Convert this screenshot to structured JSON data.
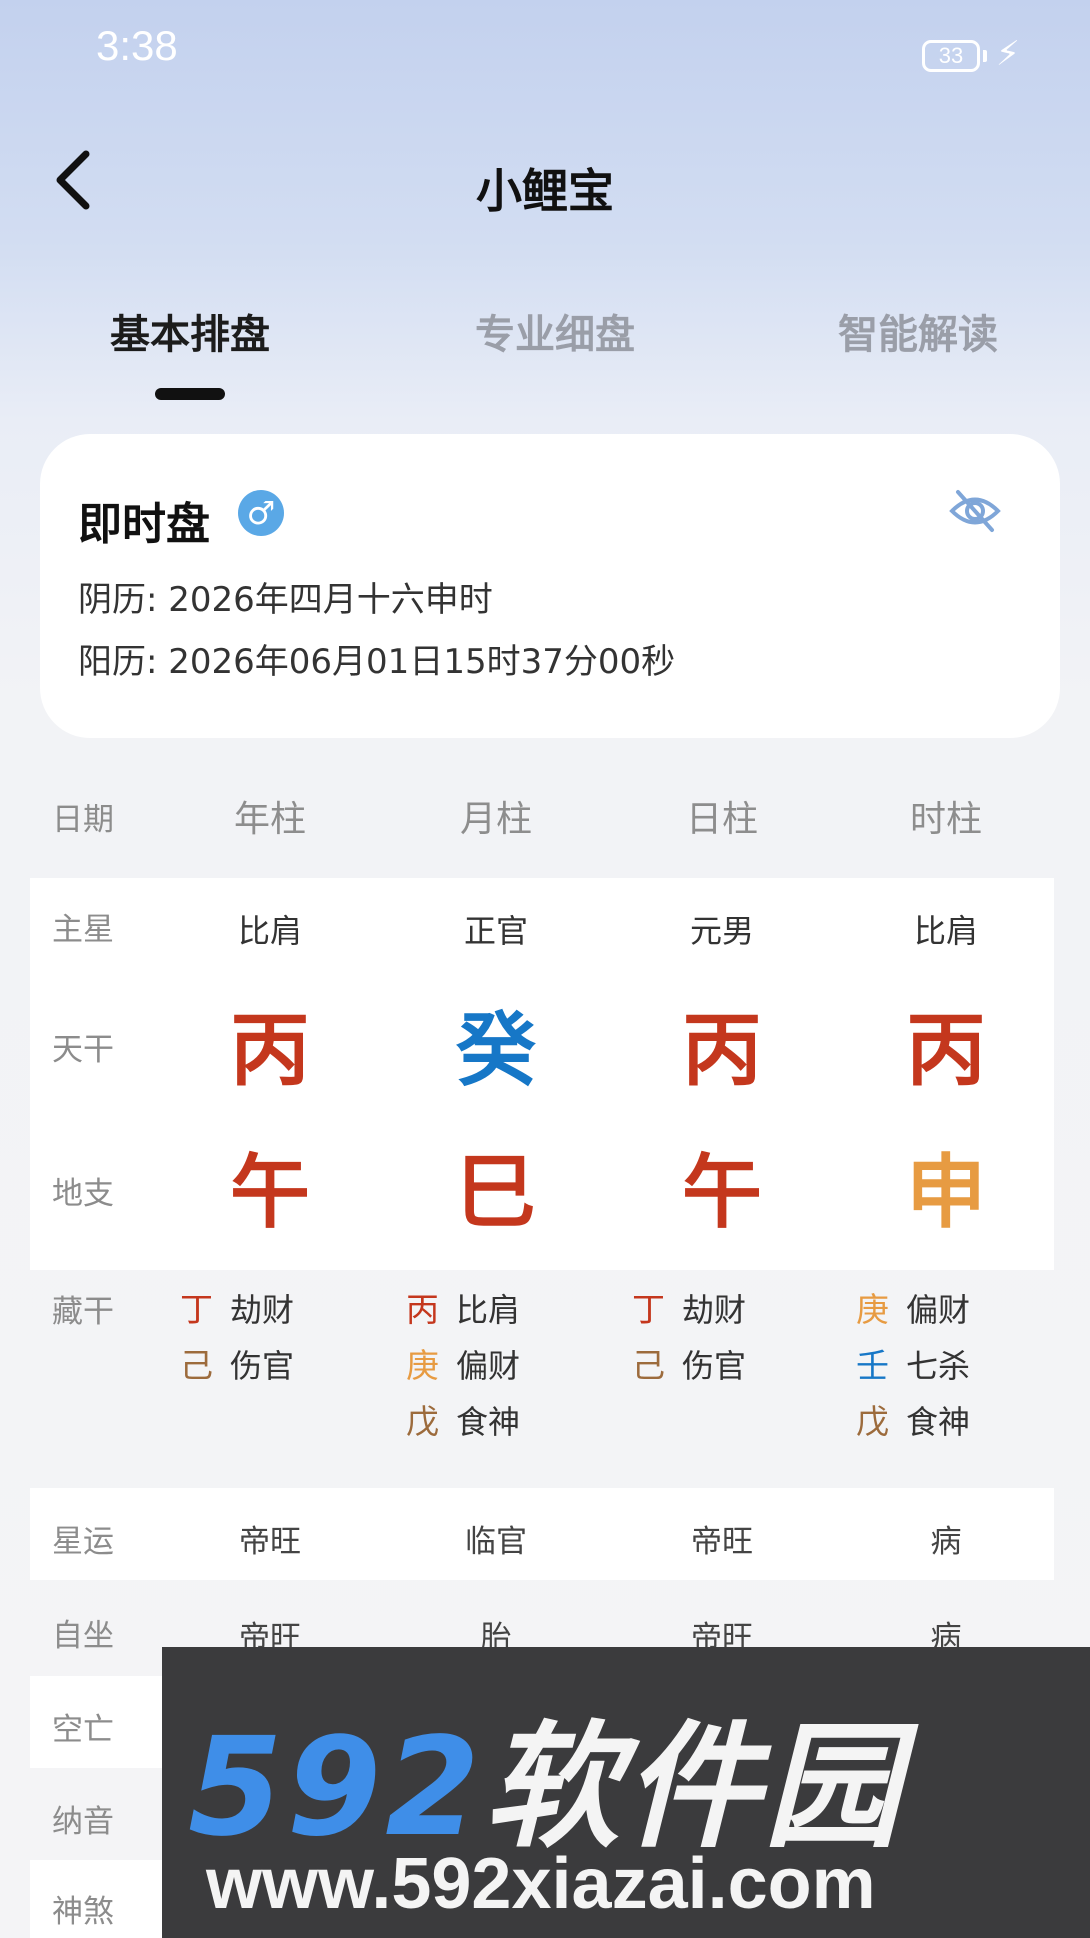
{
  "status_bar": {
    "time": "3:38",
    "battery": "33"
  },
  "header": {
    "title": "小鲤宝"
  },
  "tabs": [
    {
      "label": "基本排盘"
    },
    {
      "label": "专业细盘"
    },
    {
      "label": "智能解读"
    }
  ],
  "info_card": {
    "title": "即时盘",
    "gender_symbol": "♂",
    "lunar": "阴历: 2026年四月十六申时",
    "solar": "阳历: 2026年06月01日15时37分00秒"
  },
  "table": {
    "header": {
      "label": "日期",
      "columns": [
        "年柱",
        "月柱",
        "日柱",
        "时柱"
      ]
    },
    "zhuxing": {
      "label": "主星",
      "values": [
        "比肩",
        "正官",
        "元男",
        "比肩"
      ]
    },
    "tiangan": {
      "label": "天干",
      "values": [
        "丙",
        "癸",
        "丙",
        "丙"
      ]
    },
    "dizhi": {
      "label": "地支",
      "values": [
        "午",
        "巳",
        "午",
        "申"
      ]
    },
    "canggan": {
      "label": "藏干",
      "cols": [
        [
          {
            "gan": "丁",
            "god": "劫财"
          },
          {
            "gan": "己",
            "god": "伤官"
          }
        ],
        [
          {
            "gan": "丙",
            "god": "比肩"
          },
          {
            "gan": "庚",
            "god": "偏财"
          },
          {
            "gan": "戊",
            "god": "食神"
          }
        ],
        [
          {
            "gan": "丁",
            "god": "劫财"
          },
          {
            "gan": "己",
            "god": "伤官"
          }
        ],
        [
          {
            "gan": "庚",
            "god": "偏财"
          },
          {
            "gan": "壬",
            "god": "七杀"
          },
          {
            "gan": "戊",
            "god": "食神"
          }
        ]
      ]
    },
    "xingyun": {
      "label": "星运",
      "values": [
        "帝旺",
        "临官",
        "帝旺",
        "病"
      ]
    },
    "zizuo": {
      "label": "自坐",
      "values": [
        "帝旺",
        "胎",
        "帝旺",
        "病"
      ]
    },
    "kongwang": {
      "label": "空亡"
    },
    "nayin": {
      "label": "纳音"
    },
    "shensha": {
      "label": "神煞"
    }
  },
  "watermark": {
    "logo_num": "592",
    "logo_cn": "软件园",
    "url": "www.592xiazai.com"
  },
  "colors": {
    "fire": "#c4371d",
    "water": "#1677c7",
    "metal": "#e79b42",
    "earth": "#9c6b3c",
    "accent_blue": "#5aa8e6"
  }
}
